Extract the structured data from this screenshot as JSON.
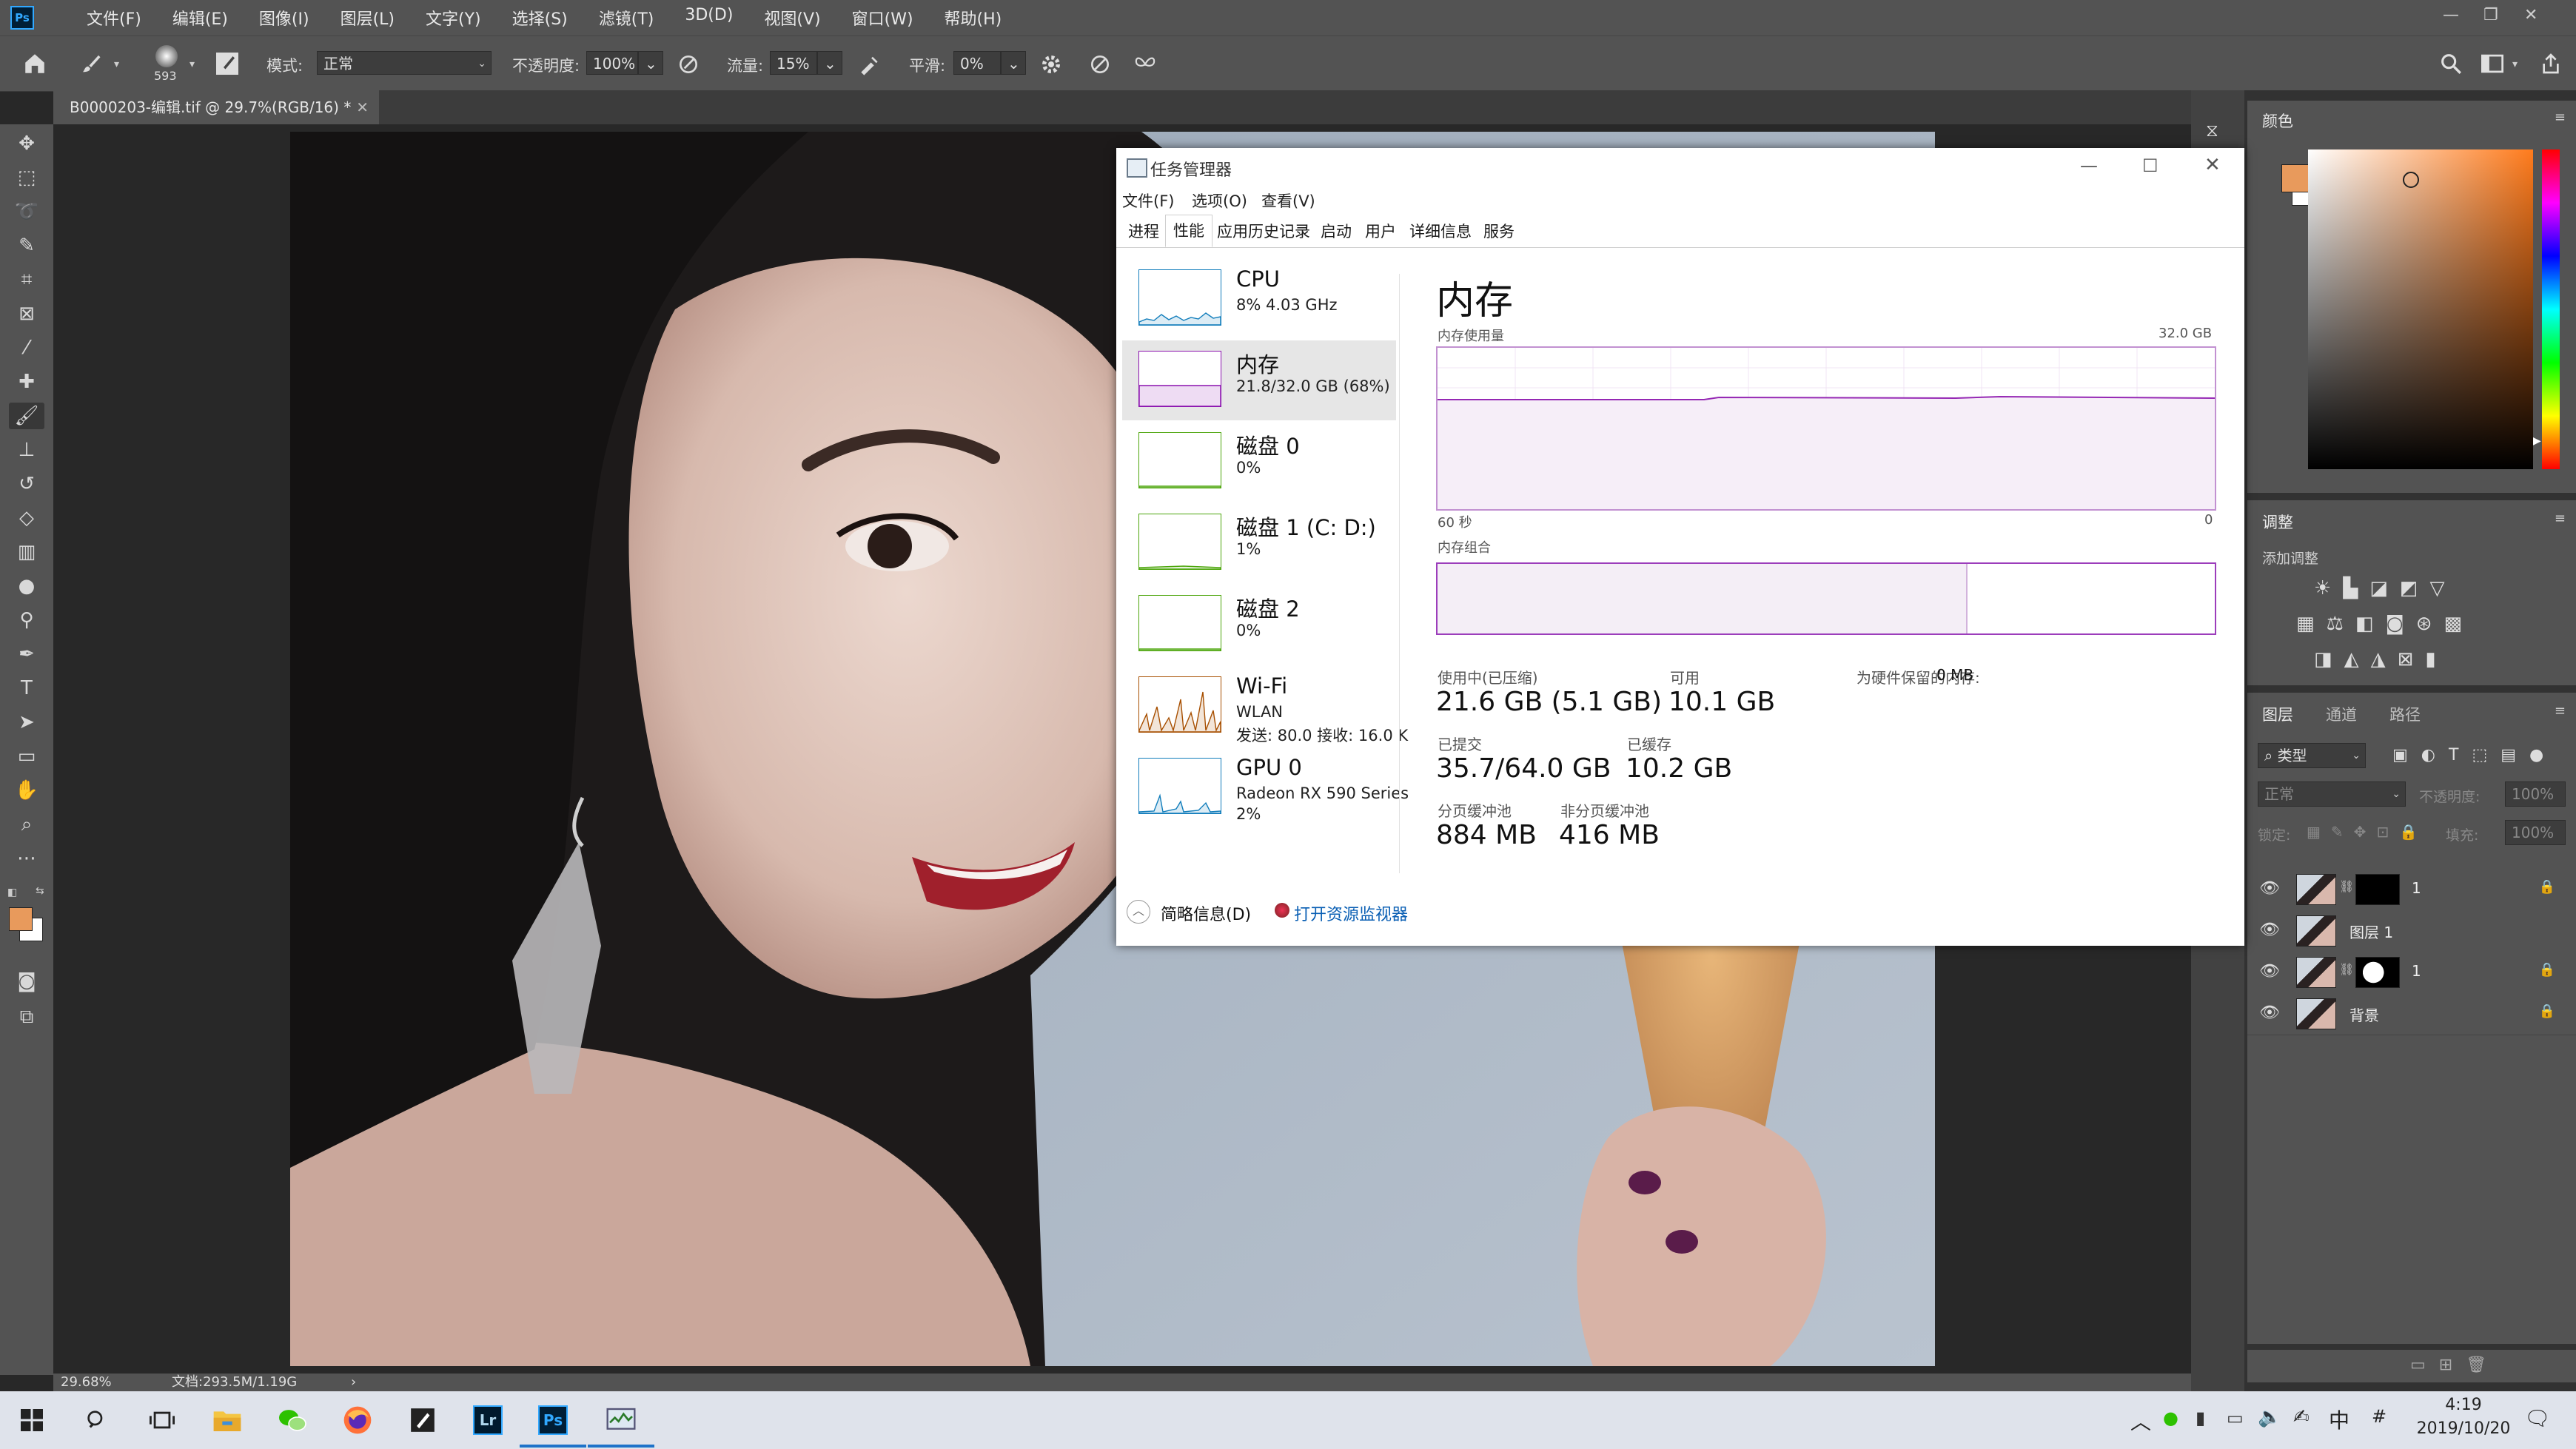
{
  "photoshop": {
    "menus": [
      "文件(F)",
      "编辑(E)",
      "图像(I)",
      "图层(L)",
      "文字(Y)",
      "选择(S)",
      "滤镜(T)",
      "3D(D)",
      "视图(V)",
      "窗口(W)",
      "帮助(H)"
    ],
    "options": {
      "brush_size": "593",
      "mode_label": "模式:",
      "mode_value": "正常",
      "opacity_label": "不透明度:",
      "opacity_value": "100%",
      "flow_label": "流量:",
      "flow_value": "15%",
      "smooth_label": "平滑:",
      "smooth_value": "0%"
    },
    "doc_tab": "B0000203-编辑.tif @ 29.7%(RGB/16) *",
    "status": {
      "zoom": "29.68%",
      "doc_info": "文档:293.5M/1.19G",
      "arrow": "›"
    },
    "panels": {
      "color_tab": "颜色",
      "adjust_tab": "调整",
      "add_adjust": "添加调整",
      "layer_tabs": [
        "图层",
        "通道",
        "路径"
      ],
      "filter_kind": "类型",
      "blend_mode": "正常",
      "opacity_label": "不透明度:",
      "opacity_value": "100%",
      "lock_label": "锁定:",
      "fill_label": "填充:",
      "fill_value": "100%"
    },
    "layers": [
      {
        "name": "1",
        "mask": "black",
        "locked": true
      },
      {
        "name": "图层 1",
        "mask": "none",
        "locked": false
      },
      {
        "name": "1",
        "mask": "white",
        "locked": true
      },
      {
        "name": "背景",
        "mask": "none",
        "locked": true
      }
    ],
    "colors": {
      "foreground": "#e89a5c",
      "background": "#ffffff"
    }
  },
  "task_manager": {
    "title": "任务管理器",
    "menu": [
      "文件(F)",
      "选项(O)",
      "查看(V)"
    ],
    "tabs": [
      "进程",
      "性能",
      "应用历史记录",
      "启动",
      "用户",
      "详细信息",
      "服务"
    ],
    "active_tab": "性能",
    "resources": [
      {
        "name": "CPU",
        "sub": "8% 4.03 GHz",
        "sub2": "",
        "color": "#117dbb"
      },
      {
        "name": "内存",
        "sub": "21.8/32.0 GB (68%)",
        "sub2": "",
        "color": "#8b12ae"
      },
      {
        "name": "磁盘 0",
        "sub": "0%",
        "sub2": "",
        "color": "#4da60c"
      },
      {
        "name": "磁盘 1 (C: D:)",
        "sub": "1%",
        "sub2": "",
        "color": "#4da60c"
      },
      {
        "name": "磁盘 2",
        "sub": "0%",
        "sub2": "",
        "color": "#4da60c"
      },
      {
        "name": "Wi-Fi",
        "sub": "WLAN",
        "sub2": "发送: 80.0 接收: 16.0 K",
        "color": "#a74f01"
      },
      {
        "name": "GPU 0",
        "sub": "Radeon RX 590 Series",
        "sub2": "2%",
        "color": "#117dbb"
      }
    ],
    "memory": {
      "heading": "内存",
      "usage_label": "内存使用量",
      "max_label": "32.0 GB",
      "time_left": "60 秒",
      "time_right": "0",
      "composition_label": "内存组合",
      "in_use_fraction": 0.68,
      "stats": {
        "in_use_label": "使用中(已压缩)",
        "in_use": "21.6 GB (5.1 GB)",
        "available_label": "可用",
        "available": "10.1 GB",
        "reserved_label": "为硬件保留的内存:",
        "reserved": "0 MB",
        "committed_label": "已提交",
        "committed": "35.7/64.0 GB",
        "cached_label": "已缓存",
        "cached": "10.2 GB",
        "paged_label": "分页缓冲池",
        "paged": "884 MB",
        "nonpaged_label": "非分页缓冲池",
        "nonpaged": "416 MB"
      }
    },
    "footer": {
      "fewer": "简略信息(D)",
      "monitor": "打开资源监视器"
    }
  },
  "taskbar": {
    "time": "4:19",
    "date": "2019/10/20",
    "ime": "中",
    "apps": [
      "start",
      "search",
      "task-view",
      "file-explorer",
      "wechat",
      "firefox",
      "notes",
      "lightroom",
      "photoshop",
      "task-manager"
    ]
  }
}
